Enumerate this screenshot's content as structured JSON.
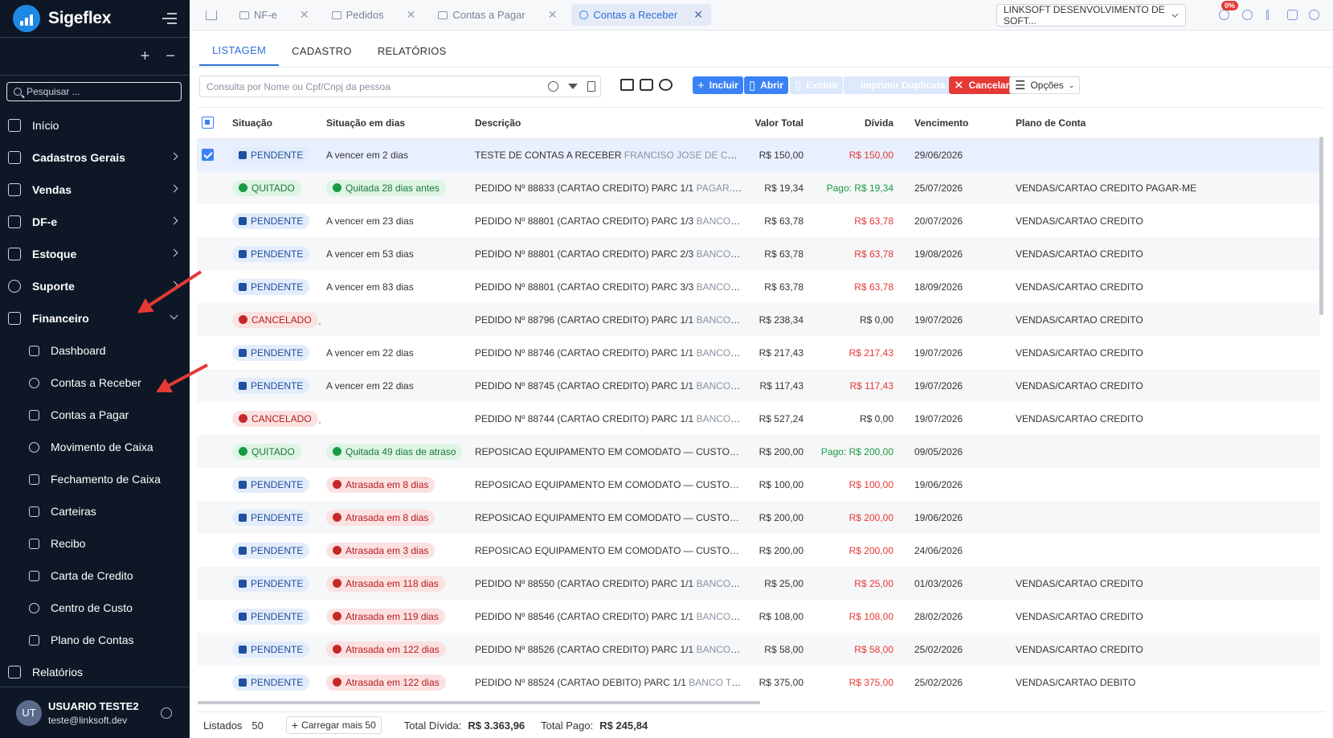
{
  "app": {
    "name": "Sigeflex"
  },
  "sidebar": {
    "search_placeholder": "Pesquisar ...",
    "items": [
      {
        "label": "Início",
        "icon": "home-icon"
      },
      {
        "label": "Cadastros Gerais",
        "icon": "grid-icon"
      },
      {
        "label": "Vendas",
        "icon": "cart-icon"
      },
      {
        "label": "DF-e",
        "icon": "document-icon"
      },
      {
        "label": "Estoque",
        "icon": "box-icon"
      },
      {
        "label": "Suporte",
        "icon": "headset-icon"
      },
      {
        "label": "Financeiro",
        "icon": "bank-icon"
      }
    ],
    "financeiro_sub": [
      {
        "label": "Dashboard",
        "icon": "dashboard-icon"
      },
      {
        "label": "Contas a Receber",
        "icon": "money-icon"
      },
      {
        "label": "Contas a Pagar",
        "icon": "pay-icon"
      },
      {
        "label": "Movimento de Caixa",
        "icon": "cash-flow-icon"
      },
      {
        "label": "Fechamento de Caixa",
        "icon": "lock-icon"
      },
      {
        "label": "Carteiras",
        "icon": "wallet-icon"
      },
      {
        "label": "Recibo",
        "icon": "receipt-icon"
      },
      {
        "label": "Carta de Credito",
        "icon": "credit-card-icon"
      },
      {
        "label": "Centro de Custo",
        "icon": "pie-icon"
      },
      {
        "label": "Plano de Contas",
        "icon": "list-icon"
      }
    ],
    "relatorios": "Relatórios",
    "user": {
      "initials": "UT",
      "name": "USUARIO TESTE2",
      "email": "teste@linksoft.dev"
    }
  },
  "topbar": {
    "tabs": [
      {
        "label": "NF-e"
      },
      {
        "label": "Pedidos"
      },
      {
        "label": "Contas a Pagar"
      },
      {
        "label": "Contas a Receber"
      }
    ],
    "company": "LINKSOFT DESENVOLVIMENTO DE SOFT...",
    "notif_badge": "0%"
  },
  "subtabs": [
    "LISTAGEM",
    "CADASTRO",
    "RELATÓRIOS"
  ],
  "toolbar": {
    "search_placeholder": "Consulta por Nome ou Cpf/Cnpj da pessoa",
    "incluir": "Incluir",
    "abrir": "Abrir",
    "excluir": "Excluir",
    "imprimir": "Imprimir Duplicata",
    "cancelar": "Cancelar",
    "opcoes": "Opções"
  },
  "table": {
    "headers": [
      "Situação",
      "Situação em dias",
      "Descrição",
      "Valor Total",
      "Dívida",
      "Vencimento",
      "Plano de Conta"
    ],
    "rows": [
      {
        "sit": "PENDENTE",
        "dias": "A vencer em 2 dias",
        "dias_kind": "plain",
        "desc": "TESTE DE CONTAS A RECEBER",
        "desc_sub": "FRANCISO JOSE DE CARVA...",
        "valor": "R$ 150,00",
        "divida": "R$ 150,00",
        "div_kind": "red",
        "venc": "29/06/2026",
        "plano": ""
      },
      {
        "sit": "QUITADO",
        "dias": "Quitada 28 dias antes",
        "dias_kind": "quit",
        "desc": "PEDIDO Nº 88833 (CARTAO CREDITO) PARC 1/1",
        "desc_sub": "PAGAR.M...",
        "valor": "R$ 19,34",
        "divida": "Pago: R$ 19,34",
        "div_kind": "green",
        "venc": "25/07/2026",
        "plano": "VENDAS/CARTAO CREDITO PAGAR-ME"
      },
      {
        "sit": "PENDENTE",
        "dias": "A vencer em 23 dias",
        "dias_kind": "plain",
        "desc": "PEDIDO Nº 88801 (CARTAO CREDITO) PARC 1/3",
        "desc_sub": "BANCO S...",
        "valor": "R$ 63,78",
        "divida": "R$ 63,78",
        "div_kind": "red",
        "venc": "20/07/2026",
        "plano": "VENDAS/CARTAO CREDITO"
      },
      {
        "sit": "PENDENTE",
        "dias": "A vencer em 53 dias",
        "dias_kind": "plain",
        "desc": "PEDIDO Nº 88801 (CARTAO CREDITO) PARC 2/3",
        "desc_sub": "BANCO S...",
        "valor": "R$ 63,78",
        "divida": "R$ 63,78",
        "div_kind": "red",
        "venc": "19/08/2026",
        "plano": "VENDAS/CARTAO CREDITO"
      },
      {
        "sit": "PENDENTE",
        "dias": "A vencer em 83 dias",
        "dias_kind": "plain",
        "desc": "PEDIDO Nº 88801 (CARTAO CREDITO) PARC 3/3",
        "desc_sub": "BANCO S...",
        "valor": "R$ 63,78",
        "divida": "R$ 63,78",
        "div_kind": "red",
        "venc": "18/09/2026",
        "plano": "VENDAS/CARTAO CREDITO"
      },
      {
        "sit": "CANCELADO",
        "dias": "",
        "dias_kind": "plain",
        "desc": "PEDIDO Nº 88796 (CARTAO CREDITO) PARC 1/1",
        "desc_sub": "BANCO S...",
        "valor": "R$ 238,34",
        "divida": "R$ 0,00",
        "div_kind": "plain",
        "venc": "19/07/2026",
        "plano": "VENDAS/CARTAO CREDITO"
      },
      {
        "sit": "PENDENTE",
        "dias": "A vencer em 22 dias",
        "dias_kind": "plain",
        "desc": "PEDIDO Nº 88746 (CARTAO CREDITO) PARC 1/1",
        "desc_sub": "BANCO S...",
        "valor": "R$ 217,43",
        "divida": "R$ 217,43",
        "div_kind": "red",
        "venc": "19/07/2026",
        "plano": "VENDAS/CARTAO CREDITO"
      },
      {
        "sit": "PENDENTE",
        "dias": "A vencer em 22 dias",
        "dias_kind": "plain",
        "desc": "PEDIDO Nº 88745 (CARTAO CREDITO) PARC 1/1",
        "desc_sub": "BANCO S...",
        "valor": "R$ 117,43",
        "divida": "R$ 117,43",
        "div_kind": "red",
        "venc": "19/07/2026",
        "plano": "VENDAS/CARTAO CREDITO"
      },
      {
        "sit": "CANCELADO",
        "dias": "",
        "dias_kind": "plain",
        "desc": "PEDIDO Nº 88744 (CARTAO CREDITO) PARC 1/1",
        "desc_sub": "BANCO S...",
        "valor": "R$ 527,24",
        "divida": "R$ 0,00",
        "div_kind": "plain",
        "venc": "19/07/2026",
        "plano": "VENDAS/CARTAO CREDITO"
      },
      {
        "sit": "QUITADO",
        "dias": "Quitada 49 dias de atraso",
        "dias_kind": "quit",
        "desc": "REPOSICAO EQUIPAMENTO EM COMODATO — CUSTODI...",
        "desc_sub": "",
        "valor": "R$ 200,00",
        "divida": "Pago: R$ 200,00",
        "div_kind": "green",
        "venc": "09/05/2026",
        "plano": ""
      },
      {
        "sit": "PENDENTE",
        "dias": "Atrasada em 8 dias",
        "dias_kind": "late",
        "desc": "REPOSICAO EQUIPAMENTO EM COMODATO — CUSTODI...",
        "desc_sub": "",
        "valor": "R$ 100,00",
        "divida": "R$ 100,00",
        "div_kind": "red",
        "venc": "19/06/2026",
        "plano": ""
      },
      {
        "sit": "PENDENTE",
        "dias": "Atrasada em 8 dias",
        "dias_kind": "late",
        "desc": "REPOSICAO EQUIPAMENTO EM COMODATO — CUSTODI...",
        "desc_sub": "",
        "valor": "R$ 200,00",
        "divida": "R$ 200,00",
        "div_kind": "red",
        "venc": "19/06/2026",
        "plano": ""
      },
      {
        "sit": "PENDENTE",
        "dias": "Atrasada em 3 dias",
        "dias_kind": "late",
        "desc": "REPOSICAO EQUIPAMENTO EM COMODATO — CUSTODI...",
        "desc_sub": "",
        "valor": "R$ 200,00",
        "divida": "R$ 200,00",
        "div_kind": "red",
        "venc": "24/06/2026",
        "plano": ""
      },
      {
        "sit": "PENDENTE",
        "dias": "Atrasada em 118 dias",
        "dias_kind": "late",
        "desc": "PEDIDO Nº 88550 (CARTAO CREDITO) PARC 1/1",
        "desc_sub": "BANCO S...",
        "valor": "R$ 25,00",
        "divida": "R$ 25,00",
        "div_kind": "red",
        "venc": "01/03/2026",
        "plano": "VENDAS/CARTAO CREDITO"
      },
      {
        "sit": "PENDENTE",
        "dias": "Atrasada em 119 dias",
        "dias_kind": "late",
        "desc": "PEDIDO Nº 88546 (CARTAO CREDITO) PARC 1/1",
        "desc_sub": "BANCO S...",
        "valor": "R$ 108,00",
        "divida": "R$ 108,00",
        "div_kind": "red",
        "venc": "28/02/2026",
        "plano": "VENDAS/CARTAO CREDITO"
      },
      {
        "sit": "PENDENTE",
        "dias": "Atrasada em 122 dias",
        "dias_kind": "late",
        "desc": "PEDIDO Nº 88526 (CARTAO CREDITO) PARC 1/1",
        "desc_sub": "BANCO S...",
        "valor": "R$ 58,00",
        "divida": "R$ 58,00",
        "div_kind": "red",
        "venc": "25/02/2026",
        "plano": "VENDAS/CARTAO CREDITO"
      },
      {
        "sit": "PENDENTE",
        "dias": "Atrasada em 122 dias",
        "dias_kind": "late",
        "desc": "PEDIDO Nº 88524 (CARTAO DEBITO) PARC 1/1",
        "desc_sub": "BANCO TO...",
        "valor": "R$ 375,00",
        "divida": "R$ 375,00",
        "div_kind": "red",
        "venc": "25/02/2026",
        "plano": "VENDAS/CARTAO DEBITO"
      }
    ]
  },
  "footer": {
    "listados_label": "Listados",
    "listados_count": "50",
    "load_more": "Carregar mais 50",
    "total_divida_label": "Total Dívida:",
    "total_divida": "R$ 3.363,96",
    "total_pago_label": "Total Pago:",
    "total_pago": "R$ 245,84"
  }
}
